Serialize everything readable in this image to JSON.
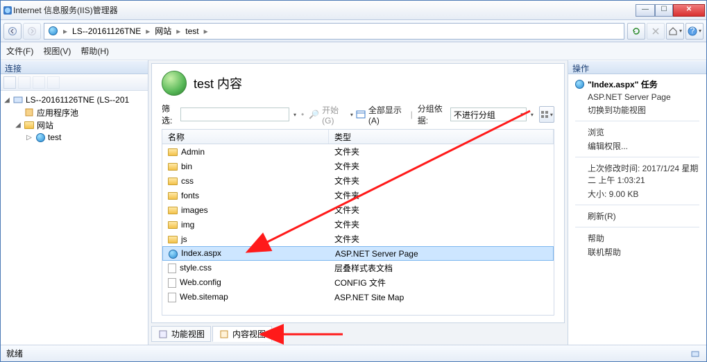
{
  "window": {
    "title": "Internet 信息服务(IIS)管理器"
  },
  "breadcrumb": {
    "host": "LS--20161126TNE",
    "level1": "网站",
    "level2": "test"
  },
  "menu": {
    "file": "文件(F)",
    "view": "视图(V)",
    "help": "帮助(H)"
  },
  "left": {
    "header": "连接",
    "host": "LS--20161126TNE (LS--201",
    "pool": "应用程序池",
    "sites": "网站",
    "site1": "test"
  },
  "center": {
    "title": "test 内容",
    "filter_label": "筛选:",
    "start_label": "开始(G)",
    "showall_label": "全部显示(A)",
    "group_label": "分组依据:",
    "group_value": "不进行分组",
    "col_name": "名称",
    "col_type": "类型",
    "rows": [
      {
        "name": "Admin",
        "type": "文件夹",
        "icon": "folder"
      },
      {
        "name": "bin",
        "type": "文件夹",
        "icon": "folder"
      },
      {
        "name": "css",
        "type": "文件夹",
        "icon": "folder"
      },
      {
        "name": "fonts",
        "type": "文件夹",
        "icon": "folder"
      },
      {
        "name": "images",
        "type": "文件夹",
        "icon": "folder"
      },
      {
        "name": "img",
        "type": "文件夹",
        "icon": "folder"
      },
      {
        "name": "js",
        "type": "文件夹",
        "icon": "folder"
      },
      {
        "name": "Index.aspx",
        "type": "ASP.NET Server Page",
        "icon": "globe",
        "selected": true
      },
      {
        "name": "style.css",
        "type": "层叠样式表文档",
        "icon": "doc"
      },
      {
        "name": "Web.config",
        "type": "CONFIG 文件",
        "icon": "doc"
      },
      {
        "name": "Web.sitemap",
        "type": "ASP.NET Site Map",
        "icon": "doc"
      }
    ],
    "tab_feature": "功能视图",
    "tab_content": "内容视图"
  },
  "right": {
    "header": "操作",
    "task_title": "\"Index.aspx\" 任务",
    "task_sub": "ASP.NET Server Page",
    "switch_view": "切换到功能视图",
    "browse": "浏览",
    "edit_perm": "编辑权限...",
    "modified_label": "上次修改时间: 2017/1/24 星期二 上午 1:03:21",
    "size_label": "大小: 9.00 KB",
    "refresh": "刷新(R)",
    "help": "帮助",
    "online_help": "联机帮助"
  },
  "status": {
    "ready": "就绪"
  }
}
